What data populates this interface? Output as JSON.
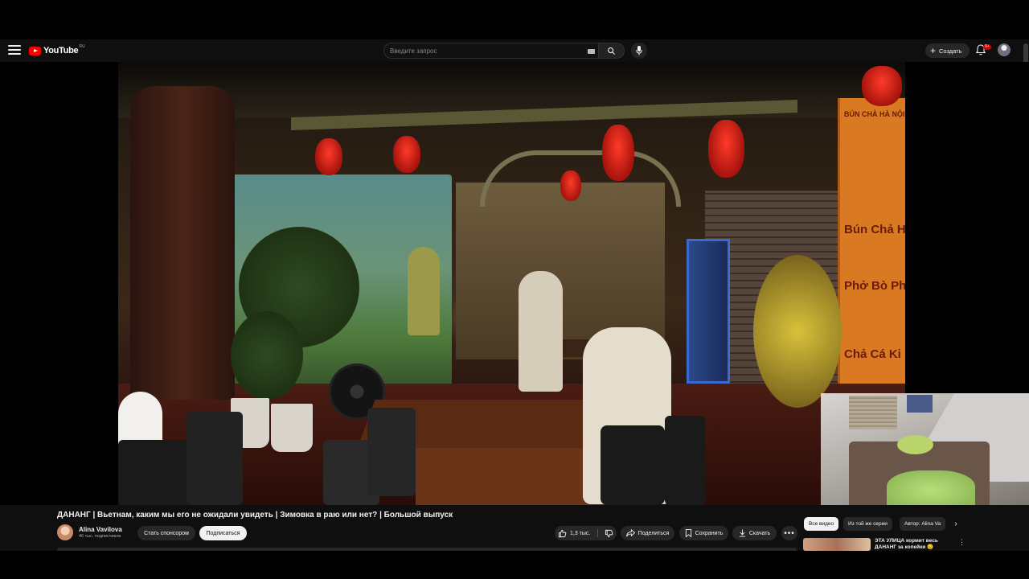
{
  "header": {
    "logo_text": "YouTube",
    "country_code": "RU",
    "search_placeholder": "Введите запрос",
    "create_label": "Создать",
    "notification_count": "9+"
  },
  "video": {
    "sign_lines": [
      "BÚN CHẢ HÀ NỘI",
      "Bún Chả Hà",
      "Phở Bò Ph",
      "Chả Cá Ki"
    ]
  },
  "info": {
    "title": "ДАНАНГ | Вьетнам, каким мы его не ожидали увидеть | Зимовка в раю или нет? | Большой выпуск",
    "channel_name": "Alina Vavilova",
    "subscribers": "46 тыс. подписчиков",
    "sponsor_label": "Стать спонсором",
    "subscribe_label": "Подписаться",
    "like_count": "1,3 тыс.",
    "share_label": "Поделиться",
    "save_label": "Сохранить",
    "download_label": "Скачать",
    "more_label": "•••"
  },
  "sidebar": {
    "chips": [
      "Все видео",
      "Из той же серии",
      "Автор: Alina Va"
    ],
    "recommendation_title": "ЭТА УЛИЦА кормит весь ДАНАНГ за копейки 🤤"
  },
  "colors": {
    "brand_red": "#ff0000",
    "background": "#0f0f0f",
    "chip_dark": "#272727",
    "text_primary": "#f1f1f1",
    "text_secondary": "#aaaaaa"
  },
  "icons": [
    "menu-icon",
    "youtube-logo-icon",
    "keyboard-icon",
    "search-icon",
    "mic-icon",
    "plus-icon",
    "bell-icon",
    "thumbs-up-icon",
    "thumbs-down-icon",
    "share-icon",
    "save-icon",
    "download-icon",
    "more-icon",
    "chevron-right-icon"
  ]
}
